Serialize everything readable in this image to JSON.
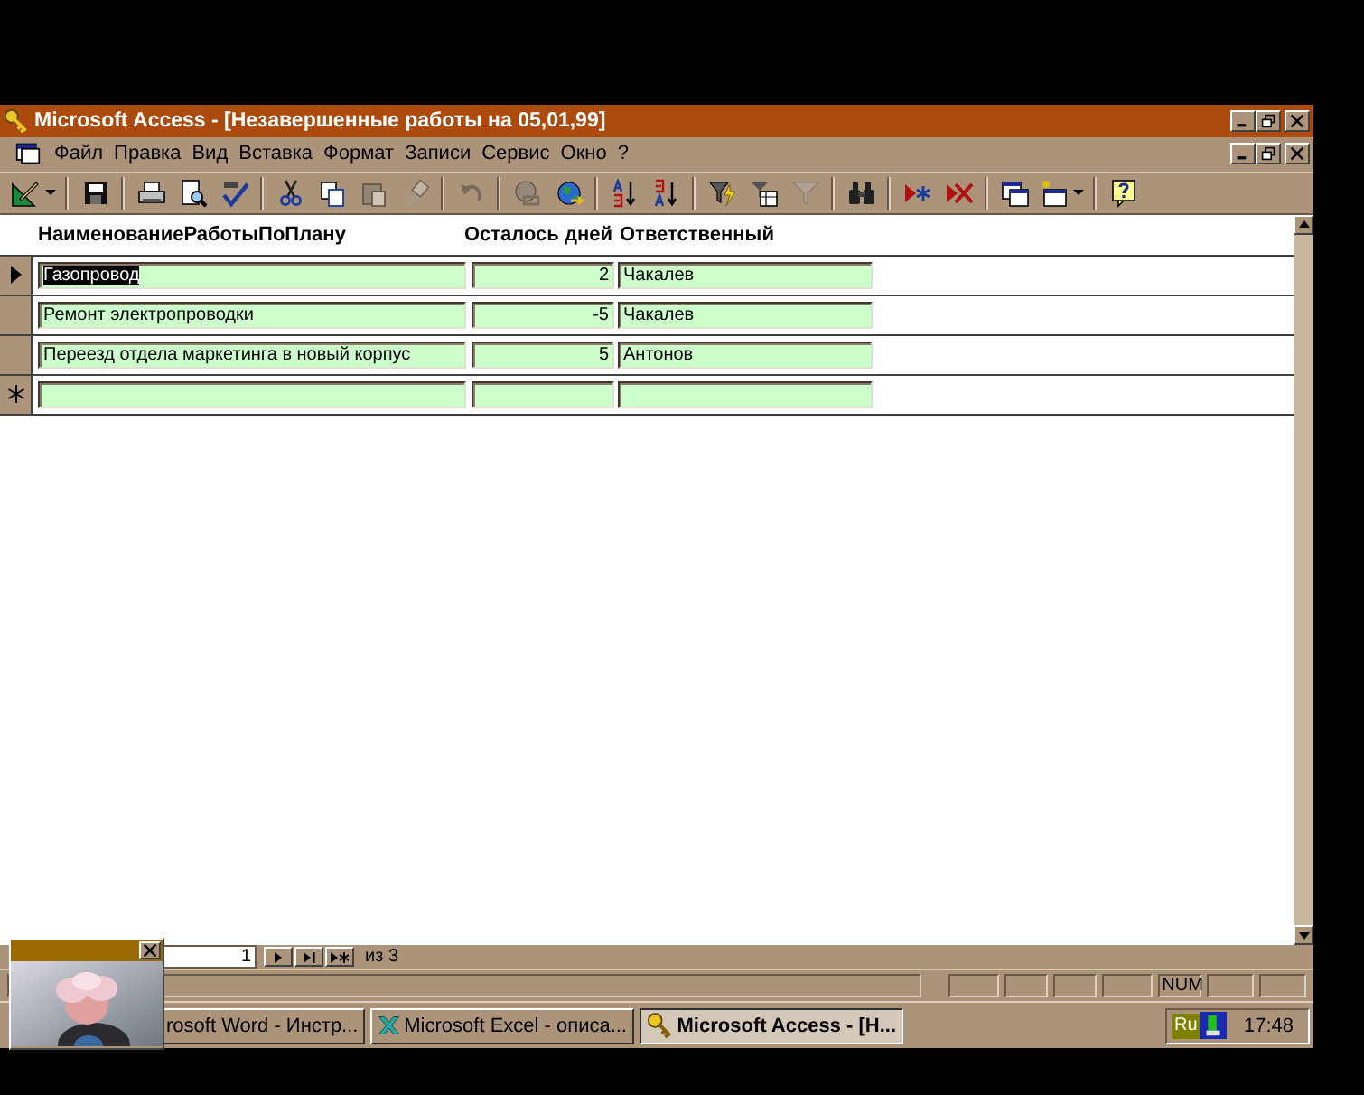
{
  "window": {
    "title": "Microsoft Access - [Незавершенные работы на 05,01,99]"
  },
  "menu": [
    "Файл",
    "Правка",
    "Вид",
    "Вставка",
    "Формат",
    "Записи",
    "Сервис",
    "Окно",
    "?"
  ],
  "toolbar": [
    [
      {
        "disabled": false,
        "dropdown": true
      }
    ],
    [
      {
        "disabled": false
      }
    ],
    [
      {
        "disabled": false
      },
      {
        "disabled": false
      },
      {
        "disabled": false
      }
    ],
    [
      {
        "disabled": false
      },
      {
        "disabled": false
      },
      {
        "disabled": true
      },
      {
        "disabled": true
      }
    ],
    [
      {
        "disabled": true
      }
    ],
    [
      {
        "disabled": true
      },
      {
        "disabled": false
      }
    ],
    [
      {
        "disabled": false
      },
      {
        "disabled": false
      }
    ],
    [
      {
        "disabled": false
      },
      {
        "disabled": false
      },
      {
        "disabled": true
      }
    ],
    [
      {
        "disabled": false
      }
    ],
    [
      {
        "disabled": false
      },
      {
        "disabled": false
      }
    ],
    [
      {
        "disabled": false
      },
      {
        "disabled": false,
        "dropdown": true
      }
    ],
    [
      {
        "disabled": false
      }
    ]
  ],
  "columns": [
    "НаименованиеРаботыПоПлану",
    "Осталось дней",
    "Ответственный"
  ],
  "rows": [
    {
      "kind": "record",
      "current": true,
      "name_selected": true,
      "name": "Газопровод",
      "days": "2",
      "responsible": "Чакалев"
    },
    {
      "kind": "record",
      "current": false,
      "name_selected": false,
      "name": "Ремонт электропроводки",
      "days": "-5",
      "responsible": "Чакалев"
    },
    {
      "kind": "record",
      "current": false,
      "name_selected": false,
      "name": "Переезд отдела маркетинга в новый корпус",
      "days": "5",
      "responsible": "Антонов"
    },
    {
      "kind": "new"
    }
  ],
  "navigator": {
    "record": "1",
    "total": "из 3"
  },
  "status_bar": {
    "num": "NUM"
  },
  "taskbar": {
    "buttons": [
      {
        "kind": "word",
        "label": "rosoft Word - Инстр...",
        "selected": false
      },
      {
        "kind": "excel",
        "label": "Microsoft Excel - описа...",
        "selected": false
      },
      {
        "kind": "access",
        "label": "Microsoft Access - [Н...",
        "selected": true
      }
    ],
    "language": "Ru",
    "clock": "17:48"
  }
}
